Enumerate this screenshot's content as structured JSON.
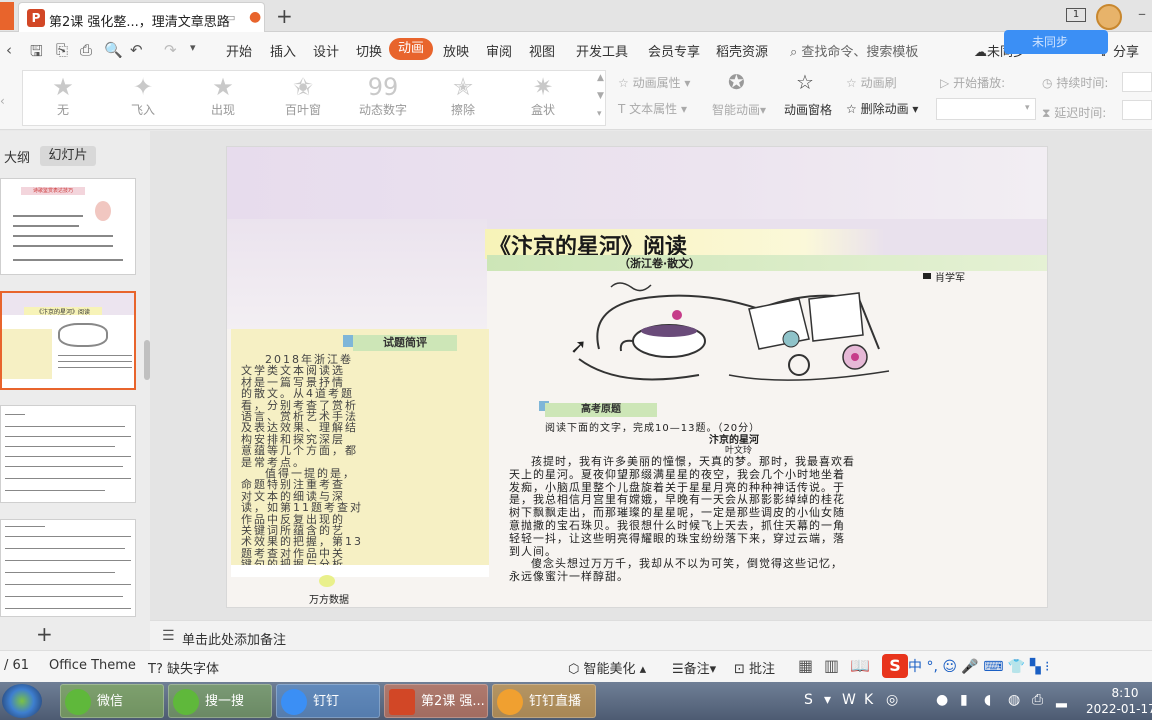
{
  "tab": {
    "title": "第2课 强化整...，理清文章思路",
    "icon": "P"
  },
  "menu": {
    "items": [
      "开始",
      "插入",
      "设计",
      "切换",
      "动画",
      "放映",
      "审阅",
      "视图",
      "开发工具",
      "会员专享",
      "稻壳资源"
    ],
    "active": "动画",
    "search": "查找命令、搜索模板",
    "cloud": "未同步",
    "share": "分享"
  },
  "animations": [
    "无",
    "飞入",
    "出现",
    "百叶窗",
    "动态数字",
    "擦除",
    "盒状"
  ],
  "ribbon": {
    "anim_props": "动画属性",
    "text_props": "文本属性",
    "smart_anim": "智能动画",
    "anim_pane": "动画窗格",
    "anim_brush": "动画刷",
    "delete_anim": "删除动画",
    "start_play": "开始播放:",
    "duration": "持续时间:",
    "delay": "延迟时间:"
  },
  "left_panel": {
    "outline_tab": "大纲",
    "slides_tab": "幻灯片",
    "thumb1_title": "诗歌鉴赏表达技巧",
    "thumb2_title": "《汴京的星河》阅读"
  },
  "slide": {
    "title": "《汴京的星河》阅读",
    "subtitle": "（浙江卷·散文）",
    "author": "肖学军",
    "review_heading": "试题简评",
    "review_lines": [
      "2018年浙江卷",
      "文学类文本阅读选",
      "材是一篇写景抒情",
      "的散文。从4道考题",
      "看，分别考查了赏析",
      "语言、赏析艺术手法",
      "及表达效果、理解结",
      "构安排和探究深层",
      "意蕴等几个方面，都",
      "是常考点。",
      "值得一提的是，",
      "命题特别注重考查",
      "对文本的细读与深",
      "读，如第11题考查对",
      "作品中反复出现的",
      "关键词所蕴含的艺",
      "术效果的把握，第13",
      "题考查对作品中关",
      "键句的把握与分析。"
    ],
    "exam_heading": "高考原题",
    "instruction": "阅读下面的文字，完成10—13题。（20分）",
    "passage_title": "汴京的星河",
    "passage_author": "叶文玲",
    "passage_lines": [
      "孩提时，我有许多美丽的憧憬，天真的梦。那时，我最喜欢看",
      "天上的星河。夏夜仰望那缀满星星的夜空，我会几个小时地坐着",
      "发痴，小脑瓜里整个儿盘旋着关于星星月亮的种种神话传说。于",
      "是，我总相信月宫里有嫦娥，早晚有一天会从那影影绰绰的桂花",
      "树下飘飘走出，而那璀璨的星星呢，一定是那些调皮的小仙女随",
      "意抛撒的宝石珠贝。我很想什么时候飞上天去，抓住天幕的一角",
      "轻轻一抖，让这些明亮得耀眼的珠宝纷纷落下来，穿过云端，落",
      "到人间。",
      "傻念头想过万万千，我却从不以为可笑，倒觉得这些记忆，",
      "永远像蜜汁一样醇甜。"
    ],
    "footer": "万方数据"
  },
  "notes": {
    "placeholder": "单击此处添加备注"
  },
  "status": {
    "page": "/ 61",
    "theme": "Office Theme",
    "missing_font": "缺失字体",
    "beautify": "智能美化",
    "notes": "备注",
    "comments": "批注"
  },
  "taskbar": {
    "items": [
      "微信",
      "搜一搜",
      "钉钉",
      "第2课 强...",
      "钉钉直播"
    ],
    "time": "8:10",
    "date": "2022-01-17"
  },
  "colors": {
    "accent": "#e8642c",
    "cloud_blue": "#3b8ff5"
  }
}
